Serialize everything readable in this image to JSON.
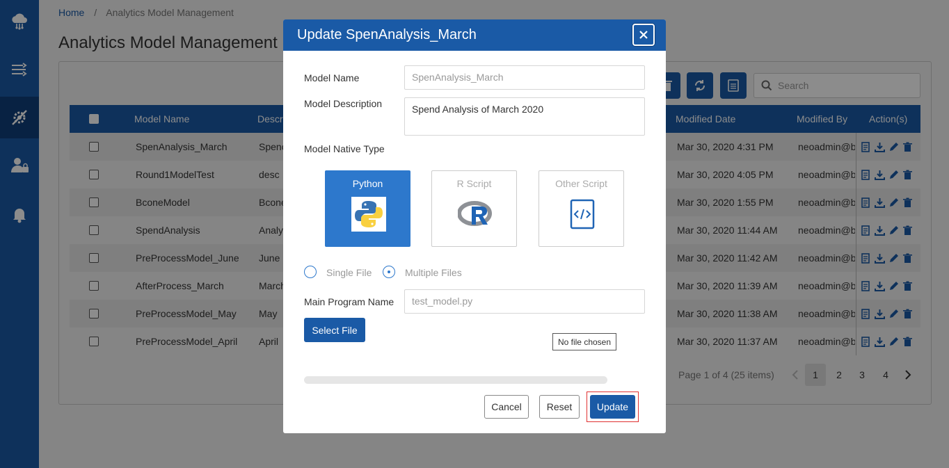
{
  "breadcrumb": {
    "home": "Home",
    "separator": "/",
    "current": "Analytics Model Management"
  },
  "page": {
    "title": "Analytics Model Management"
  },
  "sidebar": {
    "items": [
      {
        "icon": "cloud-network-icon"
      },
      {
        "icon": "transform-arrows-icon"
      },
      {
        "icon": "gear-wrench-icon",
        "active": true
      },
      {
        "icon": "user-lock-icon"
      },
      {
        "icon": "bell-icon"
      }
    ]
  },
  "search": {
    "placeholder": "Search"
  },
  "table": {
    "headers": {
      "model_name": "Model Name",
      "description": "Descri",
      "modified_date": "Modified Date",
      "modified_by": "Modified By",
      "actions": "Action(s)"
    },
    "rows": [
      {
        "name": "SpenAnalysis_March",
        "desc": "Spenc",
        "date": "Mar 30, 2020 4:31 PM",
        "by": "neoadmin@bc"
      },
      {
        "name": "Round1ModelTest",
        "desc": "desc",
        "date": "Mar 30, 2020 4:05 PM",
        "by": "neoadmin@bc"
      },
      {
        "name": "BconeModel",
        "desc": "Bcone",
        "date": "Mar 30, 2020 1:55 PM",
        "by": "neoadmin@bc"
      },
      {
        "name": "SpendAnalysis",
        "desc": "Analy",
        "date": "Mar 30, 2020 11:44 AM",
        "by": "neoadmin@bc"
      },
      {
        "name": "PreProcessModel_June",
        "desc": "June",
        "date": "Mar 30, 2020 11:42 AM",
        "by": "neoadmin@bc"
      },
      {
        "name": "AfterProcess_March",
        "desc": "March",
        "date": "Mar 30, 2020 11:39 AM",
        "by": "neoadmin@bc"
      },
      {
        "name": "PreProcessModel_May",
        "desc": "May",
        "date": "Mar 30, 2020 11:38 AM",
        "by": "neoadmin@bc"
      },
      {
        "name": "PreProcessModel_April",
        "desc": "April",
        "date": "Mar 30, 2020 11:37 AM",
        "by": "neoadmin@bc"
      }
    ]
  },
  "pagination": {
    "summary": "Page 1 of 4 (25 items)",
    "pages": [
      "1",
      "2",
      "3",
      "4"
    ],
    "current": "1"
  },
  "modal": {
    "title": "Update SpenAnalysis_March",
    "model_name_label": "Model Name",
    "model_name_value": "SpenAnalysis_March",
    "description_label": "Model Description",
    "description_value": "Spend Analysis of March 2020",
    "native_type_label": "Model Native Type",
    "types": [
      "Python",
      "R Script",
      "Other Script"
    ],
    "selected_type": "Python",
    "file_options": [
      "Single File",
      "Multiple Files"
    ],
    "selected_file_option": "Multiple Files",
    "main_program_label": "Main Program Name",
    "main_program_value": "test_model.py",
    "select_file_label": "Select File",
    "no_file_label": "No file chosen",
    "cancel_label": "Cancel",
    "reset_label": "Reset",
    "update_label": "Update"
  },
  "colors": {
    "primary": "#1a5aa6",
    "selected_card": "#2d78cc",
    "highlight": "#e03030"
  }
}
